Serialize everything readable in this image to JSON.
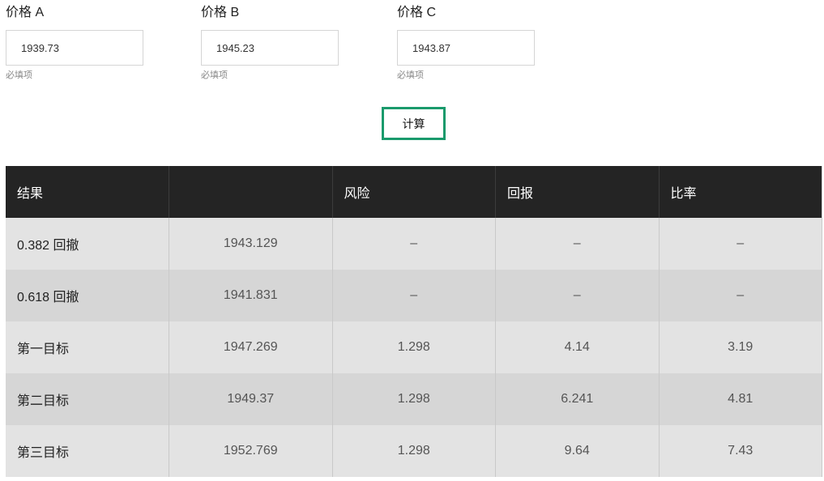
{
  "fields": [
    {
      "label": "价格 A",
      "value": "1939.73",
      "hint": "必填项"
    },
    {
      "label": "价格 B",
      "value": "1945.23",
      "hint": "必填项"
    },
    {
      "label": "价格 C",
      "value": "1943.87",
      "hint": "必填项"
    }
  ],
  "calculate_label": "计算",
  "table": {
    "headers": [
      "结果",
      "",
      "风险",
      "回报",
      "比率"
    ],
    "rows": [
      [
        "0.382 回撤",
        "1943.129",
        "–",
        "–",
        "–"
      ],
      [
        "0.618 回撤",
        "1941.831",
        "–",
        "–",
        "–"
      ],
      [
        "第一目标",
        "1947.269",
        "1.298",
        "4.14",
        "3.19"
      ],
      [
        "第二目标",
        "1949.37",
        "1.298",
        "6.241",
        "4.81"
      ],
      [
        "第三目标",
        "1952.769",
        "1.298",
        "9.64",
        "7.43"
      ]
    ]
  },
  "colors": {
    "accent": "#1a9a6c",
    "header_bg": "#242424",
    "row_light": "#e3e3e3",
    "row_dark": "#d6d6d6"
  }
}
